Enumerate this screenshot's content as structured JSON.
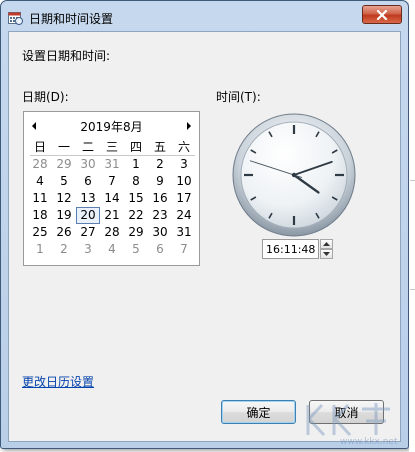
{
  "window": {
    "title": "日期和时间设置",
    "close_icon": "close-icon"
  },
  "heading": "设置日期和时间:",
  "date_label": "日期(D):",
  "time_label": "时间(T):",
  "calendar": {
    "month_title": "2019年8月",
    "prev_icon": "left-arrow-icon",
    "next_icon": "right-arrow-icon",
    "weekdays": [
      "日",
      "一",
      "二",
      "三",
      "四",
      "五",
      "六"
    ],
    "rows": [
      [
        "28",
        "29",
        "30",
        "31",
        "1",
        "2",
        "3"
      ],
      [
        "4",
        "5",
        "6",
        "7",
        "8",
        "9",
        "10"
      ],
      [
        "11",
        "12",
        "13",
        "14",
        "15",
        "16",
        "17"
      ],
      [
        "18",
        "19",
        "20",
        "21",
        "22",
        "23",
        "24"
      ],
      [
        "25",
        "26",
        "27",
        "28",
        "29",
        "30",
        "31"
      ],
      [
        "1",
        "2",
        "3",
        "4",
        "5",
        "6",
        "7"
      ]
    ],
    "selected_day": "20"
  },
  "clock": {
    "hour": 16,
    "minute": 11,
    "second": 48
  },
  "time_value": "16:11:48",
  "link_text": "更改日历设置",
  "buttons": {
    "ok": "确定",
    "cancel": "取消"
  },
  "watermark": "www.kkx.net",
  "colors": {
    "titlebar": "#c6d8ee",
    "close_button": "#c1391f",
    "link": "#0645ad",
    "selected_border": "#5a7fb0"
  }
}
